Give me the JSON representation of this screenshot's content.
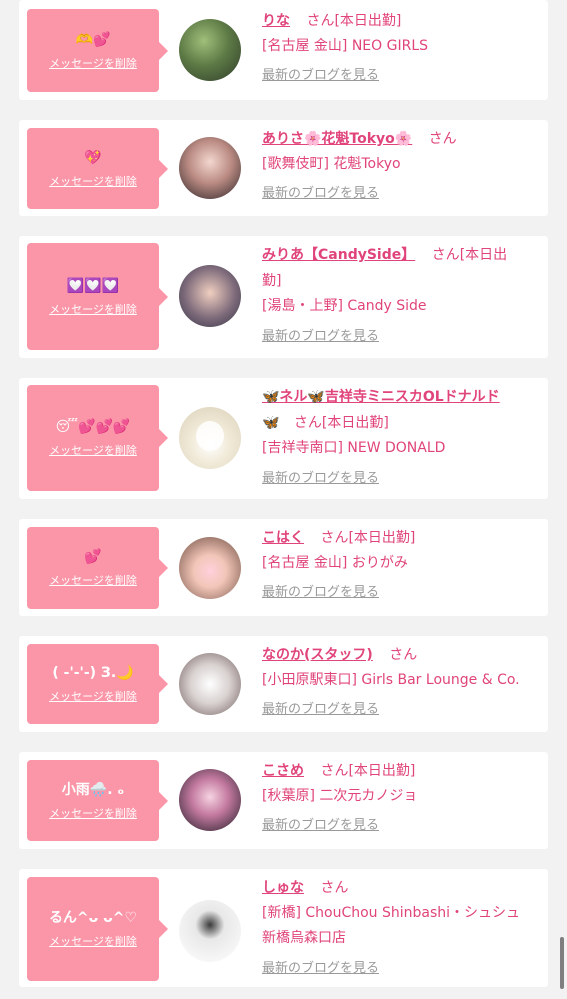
{
  "cards": [
    {
      "message": "🫶💕",
      "delete_label": "メッセージを削除",
      "name": "りな",
      "san": "さん",
      "status": "[本日出勤]",
      "name_suffix_line": "",
      "shop": "[名古屋 金山] NEO GIRLS",
      "shop_extra": "",
      "blog_label": "最新のブログを見る"
    },
    {
      "message": "💖",
      "delete_label": "メッセージを削除",
      "name": "ありさ🌸花魁Tokyo🌸",
      "san": "さん",
      "status": "",
      "name_suffix_line": "",
      "shop": "[歌舞伎町] 花魁Tokyo",
      "shop_extra": "",
      "blog_label": "最新のブログを見る"
    },
    {
      "message": "💟💟💟",
      "delete_label": "メッセージを削除",
      "name": "みりあ【CandySide】",
      "san": "さん",
      "status": "[本日出",
      "name_suffix_line": "勤]",
      "shop": "[湯島・上野] Candy Side",
      "shop_extra": "",
      "blog_label": "最新のブログを見る"
    },
    {
      "message": "😴💕💕💕",
      "delete_label": "メッセージを削除",
      "name": "🦋ネル🦋吉祥寺ミニスカOLドナルド",
      "san": "さん",
      "status": "[本日出勤]",
      "name_suffix_line": "🦋",
      "shop": "[吉祥寺南口] NEW DONALD",
      "shop_extra": "",
      "blog_label": "最新のブログを見る"
    },
    {
      "message": "💕",
      "delete_label": "メッセージを削除",
      "name": "こはく",
      "san": "さん",
      "status": "[本日出勤]",
      "name_suffix_line": "",
      "shop": "[名古屋 金山] おりがみ",
      "shop_extra": "",
      "blog_label": "最新のブログを見る"
    },
    {
      "message": "( -'-'-) З.🌙",
      "delete_label": "メッセージを削除",
      "name": "なのか(スタッフ)",
      "san": "さん",
      "status": "",
      "name_suffix_line": "",
      "shop": "[小田原駅東口] Girls Bar Lounge & Co.",
      "shop_extra": "",
      "blog_label": "最新のブログを見る"
    },
    {
      "message": "小雨🌧️. ₒ",
      "delete_label": "メッセージを削除",
      "name": "こさめ",
      "san": "さん",
      "status": "[本日出勤]",
      "name_suffix_line": "",
      "shop": "[秋葉原] 二次元カノジョ",
      "shop_extra": "",
      "blog_label": "最新のブログを見る"
    },
    {
      "message": "るん^ᴗ ᴗ^♡",
      "delete_label": "メッセージを削除",
      "name": "しゅな",
      "san": "さん",
      "status": "",
      "name_suffix_line": "",
      "shop": "[新橋] ChouChou Shinbashi・シュシュ",
      "shop_extra": "新橋烏森口店",
      "blog_label": "最新のブログを見る"
    }
  ]
}
